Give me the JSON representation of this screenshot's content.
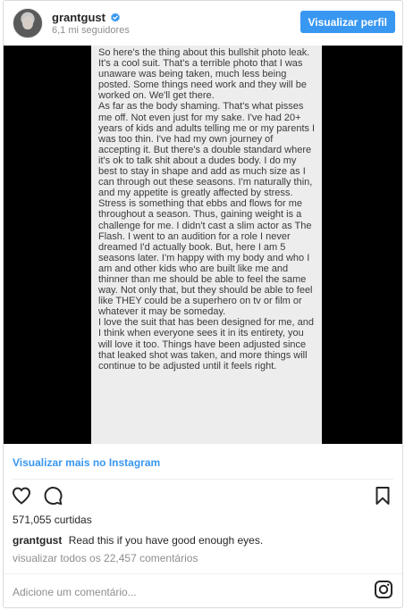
{
  "header": {
    "username": "grantgust",
    "followers": "6,1 mi seguidores",
    "view_profile_label": "Visualizar perfil"
  },
  "post": {
    "notes_text": "So here's the thing about this bullshit photo leak. It's a cool suit. That's a terrible photo that I was unaware was being taken, much less being posted. Some things need work and they will be worked on. We'll get there.\nAs far as the body shaming. That's what pisses me off. Not even just for my sake. I've had 20+ years of kids and adults telling me or my parents I was too thin. I've had my own journey of accepting it. But there's a double standard where it's ok to talk shit about a dudes body. I do my best to stay in shape and add as much size as I can through out these seasons. I'm naturally thin, and my appetite is greatly affected by stress. Stress is something that ebbs and flows for me throughout a season. Thus, gaining weight is a challenge for me. I didn't cast a slim actor as The Flash. I went to an audition for a role I never dreamed I'd actually book. But, here I am 5 seasons later. I'm happy with my body and who I am and other kids who are built like me and thinner than me should be able to feel the same way. Not only that, but they should be able to feel like THEY could be a superhero on tv or film or whatever it may be someday.\nI love the suit that has been designed for me, and I think when everyone sees it in its entirety, you will love it too. Things have been adjusted since that leaked shot was taken, and more things will continue to be adjusted until it feels right."
  },
  "view_more_label": "Visualizar mais no Instagram",
  "actions": {
    "like_icon": "heart-icon",
    "comment_icon": "comment-icon",
    "save_icon": "bookmark-icon"
  },
  "likes_text": "571,055 curtidas",
  "caption": {
    "username": "grantgust",
    "text": "Read this if you have good enough eyes."
  },
  "all_comments_text": "visualizar todos os 22,457 comentários",
  "comment_placeholder": "Adicione um comentário...",
  "colors": {
    "accent": "#3897f0",
    "text": "#262626",
    "muted": "#8e8e8e"
  }
}
